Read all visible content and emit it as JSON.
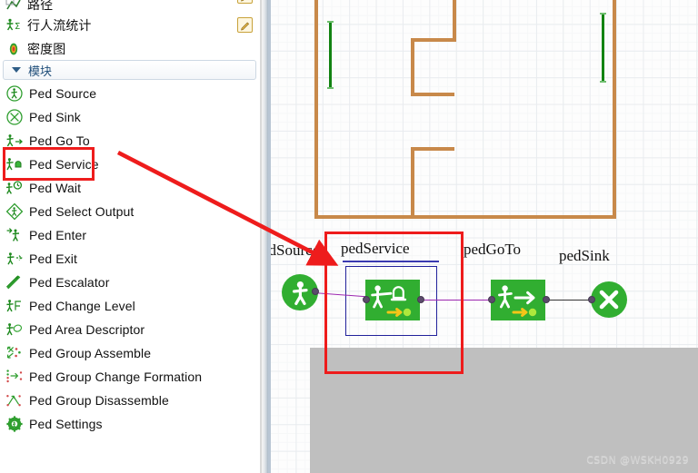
{
  "app": {
    "watermark": "CSDN @WSKH0929"
  },
  "palette": {
    "top_items": [
      {
        "label": "路径",
        "icon": "path-icon",
        "has_pencil": true,
        "clipped": true
      },
      {
        "label": "行人流统计",
        "icon": "ped-flow-statistics-icon",
        "has_pencil": true,
        "clipped": false
      },
      {
        "label": "密度图",
        "icon": "density-map-icon",
        "has_pencil": false,
        "clipped": false
      }
    ],
    "section": {
      "label": "模块",
      "expanded": true,
      "chevron": "chevron-down-icon"
    },
    "modules": [
      {
        "label": "Ped Source",
        "icon": "ped-source-icon",
        "highlighted": false
      },
      {
        "label": "Ped Sink",
        "icon": "ped-sink-icon",
        "highlighted": false
      },
      {
        "label": "Ped Go To",
        "icon": "ped-go-to-icon",
        "highlighted": false
      },
      {
        "label": "Ped Service",
        "icon": "ped-service-icon",
        "highlighted": true
      },
      {
        "label": "Ped Wait",
        "icon": "ped-wait-icon",
        "highlighted": false
      },
      {
        "label": "Ped Select Output",
        "icon": "ped-select-output-icon",
        "highlighted": false
      },
      {
        "label": "Ped Enter",
        "icon": "ped-enter-icon",
        "highlighted": false
      },
      {
        "label": "Ped Exit",
        "icon": "ped-exit-icon",
        "highlighted": false
      },
      {
        "label": "Ped Escalator",
        "icon": "ped-escalator-icon",
        "highlighted": false
      },
      {
        "label": "Ped Change Level",
        "icon": "ped-change-level-icon",
        "highlighted": false
      },
      {
        "label": "Ped Area Descriptor",
        "icon": "ped-area-descriptor-icon",
        "highlighted": false
      },
      {
        "label": "Ped Group Assemble",
        "icon": "ped-group-assemble-icon",
        "highlighted": false
      },
      {
        "label": "Ped Group Change Formation",
        "icon": "ped-group-change-formation-icon",
        "highlighted": false
      },
      {
        "label": "Ped Group Disassemble",
        "icon": "ped-group-disassemble-icon",
        "highlighted": false
      },
      {
        "label": "Ped Settings",
        "icon": "ped-settings-icon",
        "highlighted": false
      }
    ]
  },
  "canvas": {
    "blocks": [
      {
        "name": "pedSource",
        "label": "pedSource",
        "shape": "circle",
        "icon": "walking-person-icon",
        "selected": false,
        "label_clipped": true
      },
      {
        "name": "pedService",
        "label": "pedService",
        "shape": "rect",
        "icon": "ped-service-icon",
        "selected": true,
        "label_clipped": false
      },
      {
        "name": "pedGoTo",
        "label": "pedGoTo",
        "shape": "rect",
        "icon": "ped-go-to-icon",
        "selected": false,
        "label_clipped": false
      },
      {
        "name": "pedSink",
        "label": "pedSink",
        "shape": "circle",
        "icon": "cross-icon",
        "selected": false,
        "label_clipped": false
      }
    ],
    "label_clipped_text": "edSource",
    "connections": [
      {
        "from": "pedSource",
        "to": "pedService",
        "color": "#9c27b0"
      },
      {
        "from": "pedService",
        "to": "pedGoTo",
        "color": "#9c27b0"
      },
      {
        "from": "pedGoTo",
        "to": "pedSink",
        "color": "#333333"
      }
    ],
    "walls_color": "#c8894a",
    "doors_color": "#128312"
  },
  "annotations": {
    "color": "#ee1c1c",
    "highlight_list_item": "Ped Service",
    "highlight_block": "pedService",
    "arrow": {
      "from": "Ped Service list entry",
      "to": "pedService block"
    }
  },
  "colors": {
    "block_green": "#31ae31",
    "selection_blue": "#22229b",
    "annotation_red": "#ee1c1c",
    "wall_orange": "#c8894a",
    "door_green": "#128312",
    "wire_purple": "#9c27b0"
  }
}
